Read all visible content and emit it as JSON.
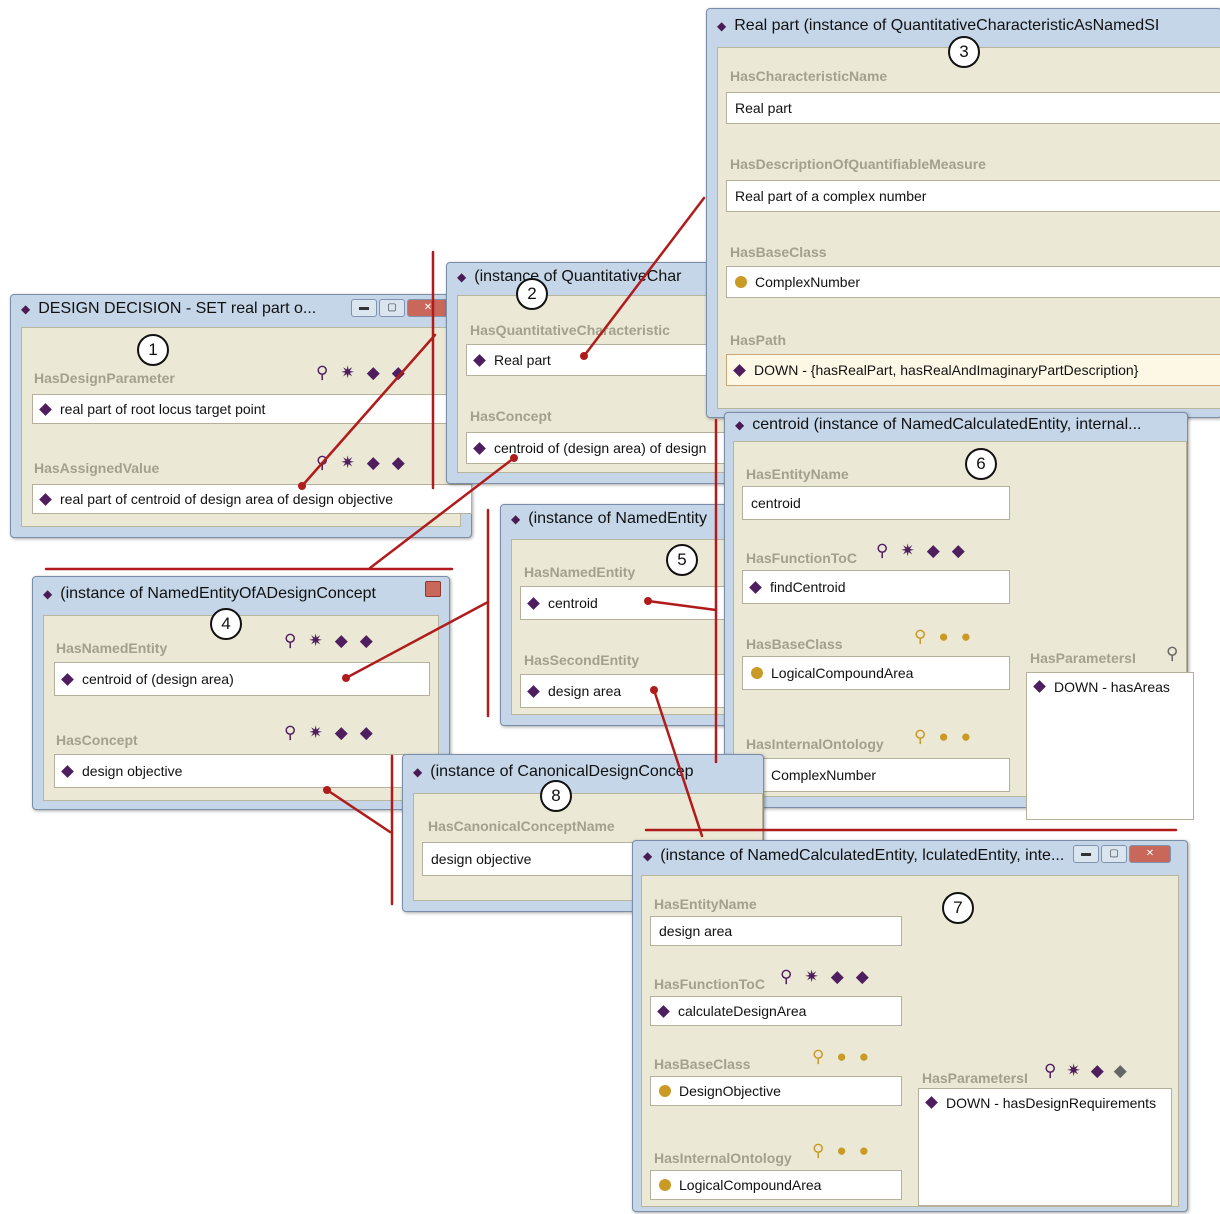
{
  "win1": {
    "title": "DESIGN DECISION - SET real part o...",
    "number": "1",
    "labels": [
      "HasDesignParameter",
      "HasAssignedValue"
    ],
    "values": [
      "real part of root locus target point",
      "real part of centroid of design area of design objective"
    ]
  },
  "win2": {
    "title": "(instance of QuantitativeChar",
    "number": "2",
    "labels": [
      "HasQuantitativeCharacteristic",
      "HasConcept"
    ],
    "values": [
      "Real part",
      "centroid of (design area) of design"
    ]
  },
  "win3": {
    "title": "Real part    (instance of QuantitativeCharacteristicAsNamedSI",
    "number": "3",
    "labels": [
      "HasCharacteristicName",
      "HasDescriptionOfQuantifiableMeasure",
      "HasBaseClass",
      "HasPath"
    ],
    "values": [
      "Real part",
      "Real part of a complex number",
      "ComplexNumber",
      "DOWN - {hasRealPart, hasRealAndImaginaryPartDescription}"
    ]
  },
  "win4": {
    "title": "(instance of NamedEntityOfADesignConcept",
    "number": "4",
    "labels": [
      "HasNamedEntity",
      "HasConcept"
    ],
    "values": [
      "centroid of (design area)",
      "design objective"
    ]
  },
  "win5": {
    "title": "(instance of NamedEntity",
    "number": "5",
    "labels": [
      "HasNamedEntity",
      "HasSecondEntity"
    ],
    "values": [
      "centroid",
      "design area"
    ]
  },
  "win6": {
    "title": "centroid    (instance of NamedCalculatedEntity, internal...",
    "number": "6",
    "labels": [
      "HasEntityName",
      "HasFunctionToC",
      "HasBaseClass",
      "HasInternalOntology",
      "HasParametersI"
    ],
    "values": [
      "centroid",
      "findCentroid",
      "LogicalCompoundArea",
      "ComplexNumber",
      "DOWN - hasAreas"
    ]
  },
  "win7": {
    "title": "(instance of NamedCalculatedEntity, lculatedEntity, inte...",
    "number": "7",
    "labels": [
      "HasEntityName",
      "HasFunctionToC",
      "HasBaseClass",
      "HasInternalOntology",
      "HasParametersI"
    ],
    "values": [
      "design area",
      "calculateDesignArea",
      "DesignObjective",
      "LogicalCompoundArea",
      "DOWN - hasDesignRequirements"
    ]
  },
  "win8": {
    "title": "(instance of CanonicalDesignConcep",
    "number": "8",
    "labels": [
      "HasCanonicalConceptName"
    ],
    "values": [
      "design objective"
    ]
  },
  "icons": {
    "search": "search-icon",
    "browse": "browse-icon",
    "add_instance": "add-instance-icon",
    "remove_instance": "remove-instance-icon"
  },
  "colors": {
    "connector": "#b01c1c",
    "panel": "#ece8d6",
    "frame": "#c5d6e8",
    "instance": "#4f1e5f",
    "class": "#c99a26"
  }
}
